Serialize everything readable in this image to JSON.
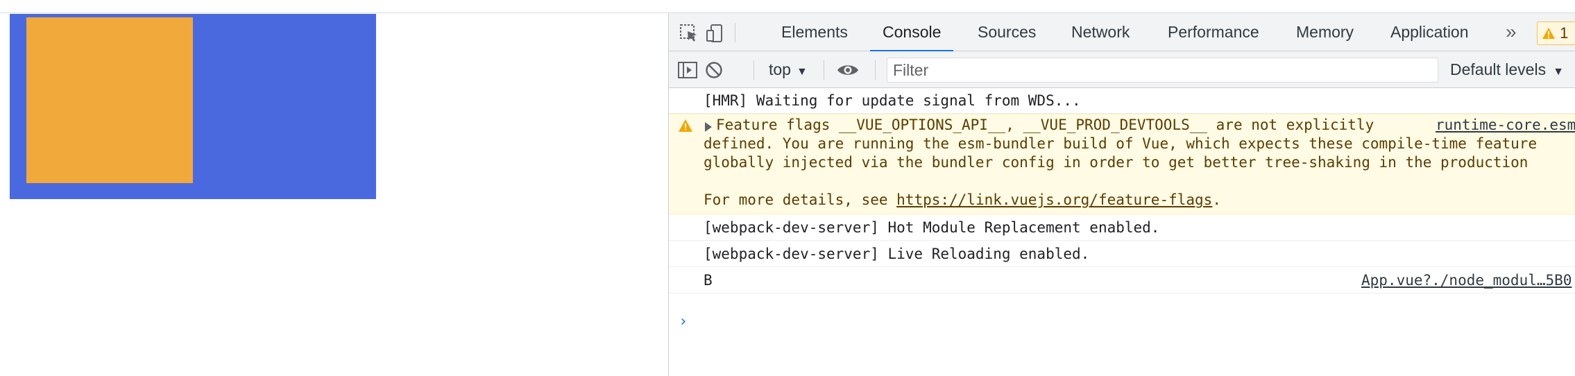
{
  "page": {
    "outer_box_color": "#4b69de",
    "inner_box_color": "#f2a93b"
  },
  "devtools": {
    "tabs": [
      {
        "label": "Elements",
        "active": false
      },
      {
        "label": "Console",
        "active": true
      },
      {
        "label": "Sources",
        "active": false
      },
      {
        "label": "Network",
        "active": false
      },
      {
        "label": "Performance",
        "active": false
      },
      {
        "label": "Memory",
        "active": false
      },
      {
        "label": "Application",
        "active": false
      }
    ],
    "more_tabs_glyph": "»",
    "warning_count": "1",
    "toolbar": {
      "context": "top",
      "filter_placeholder": "Filter",
      "levels": "Default levels"
    },
    "messages": {
      "hmr": "[HMR] Waiting for update signal from WDS...",
      "warning": {
        "line1": "Feature flags __VUE_OPTIONS_API__, __VUE_PROD_DEVTOOLS__ are not explicitly",
        "line2": "defined. You are running the esm-bundler build of Vue, which expects these compile-time feature",
        "line3": "globally injected via the bundler config in order to get better tree-shaking in the production",
        "line4_prefix": "For more details, see ",
        "line4_link": "https://link.vuejs.org/feature-flags",
        "line4_suffix": ".",
        "source": "runtime-core.esm"
      },
      "hmr_enabled": "[webpack-dev-server] Hot Module Replacement enabled.",
      "live_reload": "[webpack-dev-server] Live Reloading enabled.",
      "log_b": "B",
      "log_b_source": "App.vue?./node_modul…5B0"
    },
    "prompt_glyph": "›",
    "accent_color": "#1a73e8",
    "warning_bg": "#fffbe5"
  }
}
